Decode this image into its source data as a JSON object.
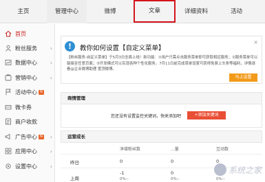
{
  "nav": {
    "tabs": [
      {
        "label": "主页"
      },
      {
        "label": "管理中心"
      },
      {
        "label": "微博"
      },
      {
        "label": "文章"
      },
      {
        "label": "详细资料"
      },
      {
        "label": "活动"
      }
    ]
  },
  "sidebar": {
    "items": [
      {
        "label": "首页",
        "icon": "home-icon"
      },
      {
        "label": "粉丝服务",
        "icon": "fans-icon"
      },
      {
        "label": "数据中心",
        "icon": "data-icon"
      },
      {
        "label": "营销中心",
        "icon": "marketing-icon"
      },
      {
        "label": "活动中心",
        "icon": "flag-icon",
        "badge": "new"
      },
      {
        "label": "微卡券",
        "icon": "coupon-icon"
      },
      {
        "label": "商户收款",
        "icon": "store-icon"
      },
      {
        "label": "广告中心",
        "icon": "ad-icon",
        "badge": "new"
      },
      {
        "label": "应用中心",
        "icon": "apps-icon"
      },
      {
        "label": "设置中心",
        "icon": "settings-icon"
      }
    ]
  },
  "notice": {
    "icon_glyph": "!",
    "title": "教你如何设置【自定义菜单】",
    "close": "×",
    "text": "【粉丝服务-自定义菜单】于5月3日全面上线！新功能：①用户只需点击服务菜单即可获取相应服务；②服务菜单可以链接至任意页面；③开发模式可以实现各种个性化服务。7月11日前完成菜单设置可获得免费上头条等福利，详情请看@企业微博助理 置顶微博。",
    "button": "马上设置"
  },
  "private_msg": {
    "title": "商情管理",
    "text": "您还没有设置监控关键词，快来添加吧",
    "button": "+添加关键词"
  },
  "growth": {
    "title": "运营成长",
    "headers": [
      "净增粉丝数",
      "...量",
      "互动数"
    ],
    "rows": [
      {
        "label": "昨日",
        "values": [
          "0",
          "0",
          "0"
        ]
      },
      {
        "label": "上周",
        "values": [
          "-1",
          "0",
          "0"
        ],
        "sub": [
          "0%--",
          "0%--",
          "0%--"
        ]
      }
    ]
  },
  "watermark": {
    "text": "系统之家"
  }
}
